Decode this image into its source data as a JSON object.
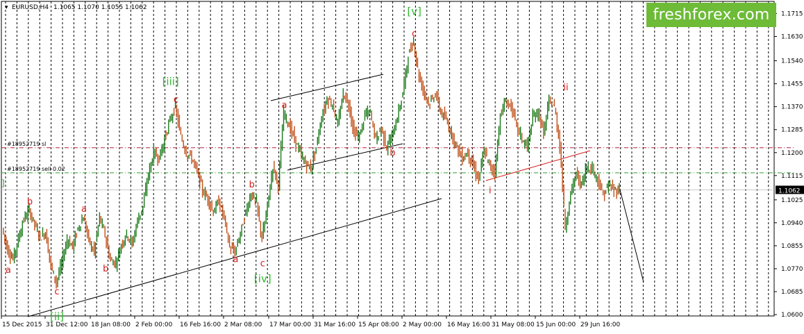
{
  "header": {
    "symbol": "EURUSD,H4",
    "ohlc": "1.1065 1.1070 1.1055 1.1062",
    "tp_marker": "]"
  },
  "brand": {
    "text": "freshforex.com"
  },
  "colors": {
    "bull_candle": "#1a7a1a",
    "bear_candle": "#c0501a",
    "wave_label": "#d41a1a",
    "major_wave_label": "#2db82d",
    "sl_line": "#b02040",
    "sell_line": "#2da02d",
    "price_box": "#000000"
  },
  "levels": {
    "sl": {
      "label": "#18952719 sl",
      "price": 1.1218
    },
    "sell": {
      "label": "#18952719 sell 0.02",
      "price": 1.1125
    }
  },
  "current_price": "1.1062",
  "chart_data": {
    "type": "line",
    "title": "EURUSD,H4",
    "ylim": [
      1.0595,
      1.176
    ],
    "y_ticks": [
      "1.1715",
      "1.1630",
      "1.1540",
      "1.1455",
      "1.1370",
      "1.1285",
      "1.1200",
      "1.1115",
      "1.1025",
      "1.0940",
      "1.0855",
      "1.0770",
      "1.0685",
      "1.0600"
    ],
    "x_labels": [
      "15 Dec 2015",
      "31 Dec 12:00",
      "18 Jan 08:00",
      "2 Feb 00:00",
      "16 Feb 16:00",
      "2 Mar 08:00",
      "17 Mar 00:00",
      "31 Mar 16:00",
      "15 Apr 08:00",
      "2 May 00:00",
      "16 May 16:00",
      "31 May 08:00",
      "15 Jun 00:00",
      "29 Jun 16:00"
    ],
    "grid": "vertical dotted",
    "series": [
      {
        "values": [
          1.092,
          1.084,
          1.0805,
          1.088,
          1.0955,
          1.0985,
          1.0935,
          1.0885,
          1.0905,
          1.078,
          1.072,
          1.079,
          1.088,
          1.085,
          1.092,
          1.096,
          1.0875,
          1.083,
          1.096,
          1.0895,
          1.08,
          1.079,
          1.086,
          1.09,
          1.086,
          1.095,
          1.1,
          1.112,
          1.12,
          1.118,
          1.125,
          1.132,
          1.137,
          1.126,
          1.12,
          1.118,
          1.113,
          1.106,
          1.103,
          1.098,
          1.102,
          1.096,
          1.085,
          1.083,
          1.09,
          1.098,
          1.105,
          1.101,
          1.088,
          1.1,
          1.115,
          1.108,
          1.135,
          1.13,
          1.125,
          1.12,
          1.116,
          1.114,
          1.122,
          1.133,
          1.14,
          1.138,
          1.13,
          1.142,
          1.138,
          1.127,
          1.126,
          1.134,
          1.135,
          1.125,
          1.129,
          1.122,
          1.126,
          1.133,
          1.142,
          1.156,
          1.161,
          1.148,
          1.142,
          1.138,
          1.142,
          1.135,
          1.132,
          1.127,
          1.122,
          1.118,
          1.12,
          1.115,
          1.11,
          1.121,
          1.115,
          1.113,
          1.134,
          1.139,
          1.137,
          1.13,
          1.125,
          1.122,
          1.133,
          1.135,
          1.127,
          1.139,
          1.137,
          1.123,
          1.092,
          1.105,
          1.112,
          1.108,
          1.115,
          1.114,
          1.11,
          1.104,
          1.108,
          1.106,
          1.1062
        ]
      }
    ],
    "forecast": {
      "from": 1.1062,
      "to": 1.072
    },
    "wave_labels": [
      {
        "text": "a",
        "i": 1,
        "price": 1.0785,
        "pos": "below",
        "major": false
      },
      {
        "text": "b",
        "i": 5,
        "price": 1.0998,
        "pos": "above",
        "major": false
      },
      {
        "text": "c",
        "i": 10,
        "price": 1.0705,
        "pos": "below",
        "major": false
      },
      {
        "text": "[ii]",
        "i": 10,
        "price": 1.061,
        "pos": "below",
        "major": true
      },
      {
        "text": "a",
        "i": 15,
        "price": 1.097,
        "pos": "above",
        "major": false
      },
      {
        "text": "b",
        "i": 19,
        "price": 1.079,
        "pos": "below",
        "major": false
      },
      {
        "text": "c",
        "i": 32,
        "price": 1.1375,
        "pos": "above",
        "major": false
      },
      {
        "text": "[iii]",
        "i": 31,
        "price": 1.144,
        "pos": "above",
        "major": true
      },
      {
        "text": "a",
        "i": 43,
        "price": 1.0825,
        "pos": "below",
        "major": false
      },
      {
        "text": "b",
        "i": 46,
        "price": 1.106,
        "pos": "above",
        "major": false
      },
      {
        "text": "c",
        "i": 48,
        "price": 1.081,
        "pos": "below",
        "major": false
      },
      {
        "text": "[iv]",
        "i": 48,
        "price": 1.075,
        "pos": "below",
        "major": true
      },
      {
        "text": "a",
        "i": 52,
        "price": 1.1355,
        "pos": "above",
        "major": false
      },
      {
        "text": "b",
        "i": 72,
        "price": 1.122,
        "pos": "below",
        "major": false
      },
      {
        "text": "c",
        "i": 76,
        "price": 1.162,
        "pos": "above",
        "major": false
      },
      {
        "text": "[v]",
        "i": 76,
        "price": 1.17,
        "pos": "above",
        "major": true
      },
      {
        "text": "i",
        "i": 90,
        "price": 1.108,
        "pos": "below",
        "major": false
      },
      {
        "text": "ii",
        "i": 104,
        "price": 1.142,
        "pos": "above",
        "major": false
      }
    ]
  }
}
